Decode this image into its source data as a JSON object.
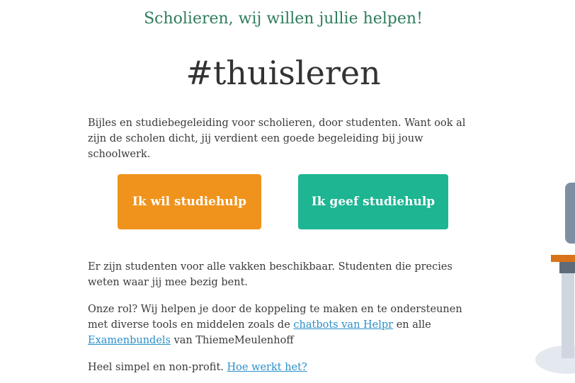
{
  "header": {
    "tagline": "Scholieren, wij willen jullie helpen!",
    "hashtag": "#thuisleren"
  },
  "intro": {
    "text": "Bijles en studiebegeleiding voor scholieren, door studenten. Want ook al zijn de scholen dicht, jij verdient een goede begeleiding bij jouw schoolwerk."
  },
  "buttons": {
    "want_help": "Ik wil studiehulp",
    "give_help": "Ik geef studiehulp"
  },
  "body": {
    "students_text": "Er zijn studenten voor alle vakken beschikbaar. Studenten die precies weten waar jij mee bezig bent.",
    "role_prefix": "Onze rol? Wij helpen je door de koppeling te maken en te ondersteunen met diverse tools en middelen zoals de ",
    "chatbots_link": "chatbots van Helpr",
    "role_middle": " en alle ",
    "exam_link": "Examenbundels",
    "role_suffix": " van ThiemeMeulenhoff",
    "simple_prefix": "Heel simpel en non-profit. ",
    "how_link": "Hoe werkt het?"
  },
  "colors": {
    "tagline": "#2e7d5b",
    "orange_button": "#f0931c",
    "teal_button": "#1db592",
    "link": "#2a8fc9"
  }
}
